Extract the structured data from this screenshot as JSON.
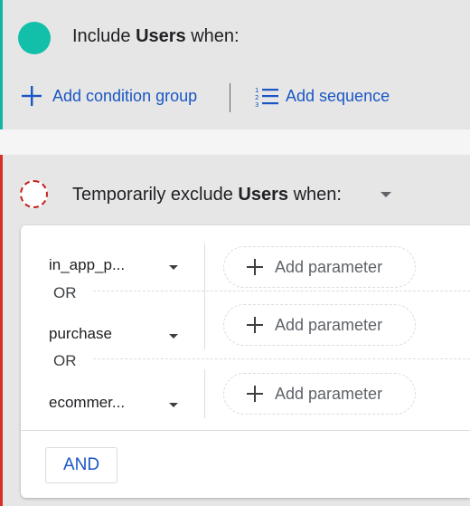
{
  "include": {
    "prefix": "Include ",
    "subject": "Users",
    "suffix": " when:",
    "add_condition_group": "Add condition group",
    "add_sequence": "Add sequence",
    "dot_color": "#12bfa9",
    "accent_color": "#12b5a4"
  },
  "exclude": {
    "prefix": "Temporarily exclude ",
    "subject": "Users",
    "suffix": " when:",
    "accent_color": "#d93025",
    "conditions": [
      {
        "event": "in_app_p...",
        "add_parameter": "Add parameter"
      },
      {
        "event": "purchase",
        "add_parameter": "Add parameter"
      },
      {
        "event": "ecommer...",
        "add_parameter": "Add parameter"
      }
    ],
    "or_labels": [
      "OR",
      "OR"
    ],
    "and_button": "AND"
  },
  "icons": {
    "include_status": "filled-circle-icon",
    "add_condition": "plus-icon",
    "add_sequence": "numbered-list-icon",
    "exclude_status": "dashed-circle-icon",
    "dropdown": "caret-down-icon",
    "add_parameter": "plus-icon"
  },
  "colors": {
    "link_blue": "#1a56c4"
  }
}
